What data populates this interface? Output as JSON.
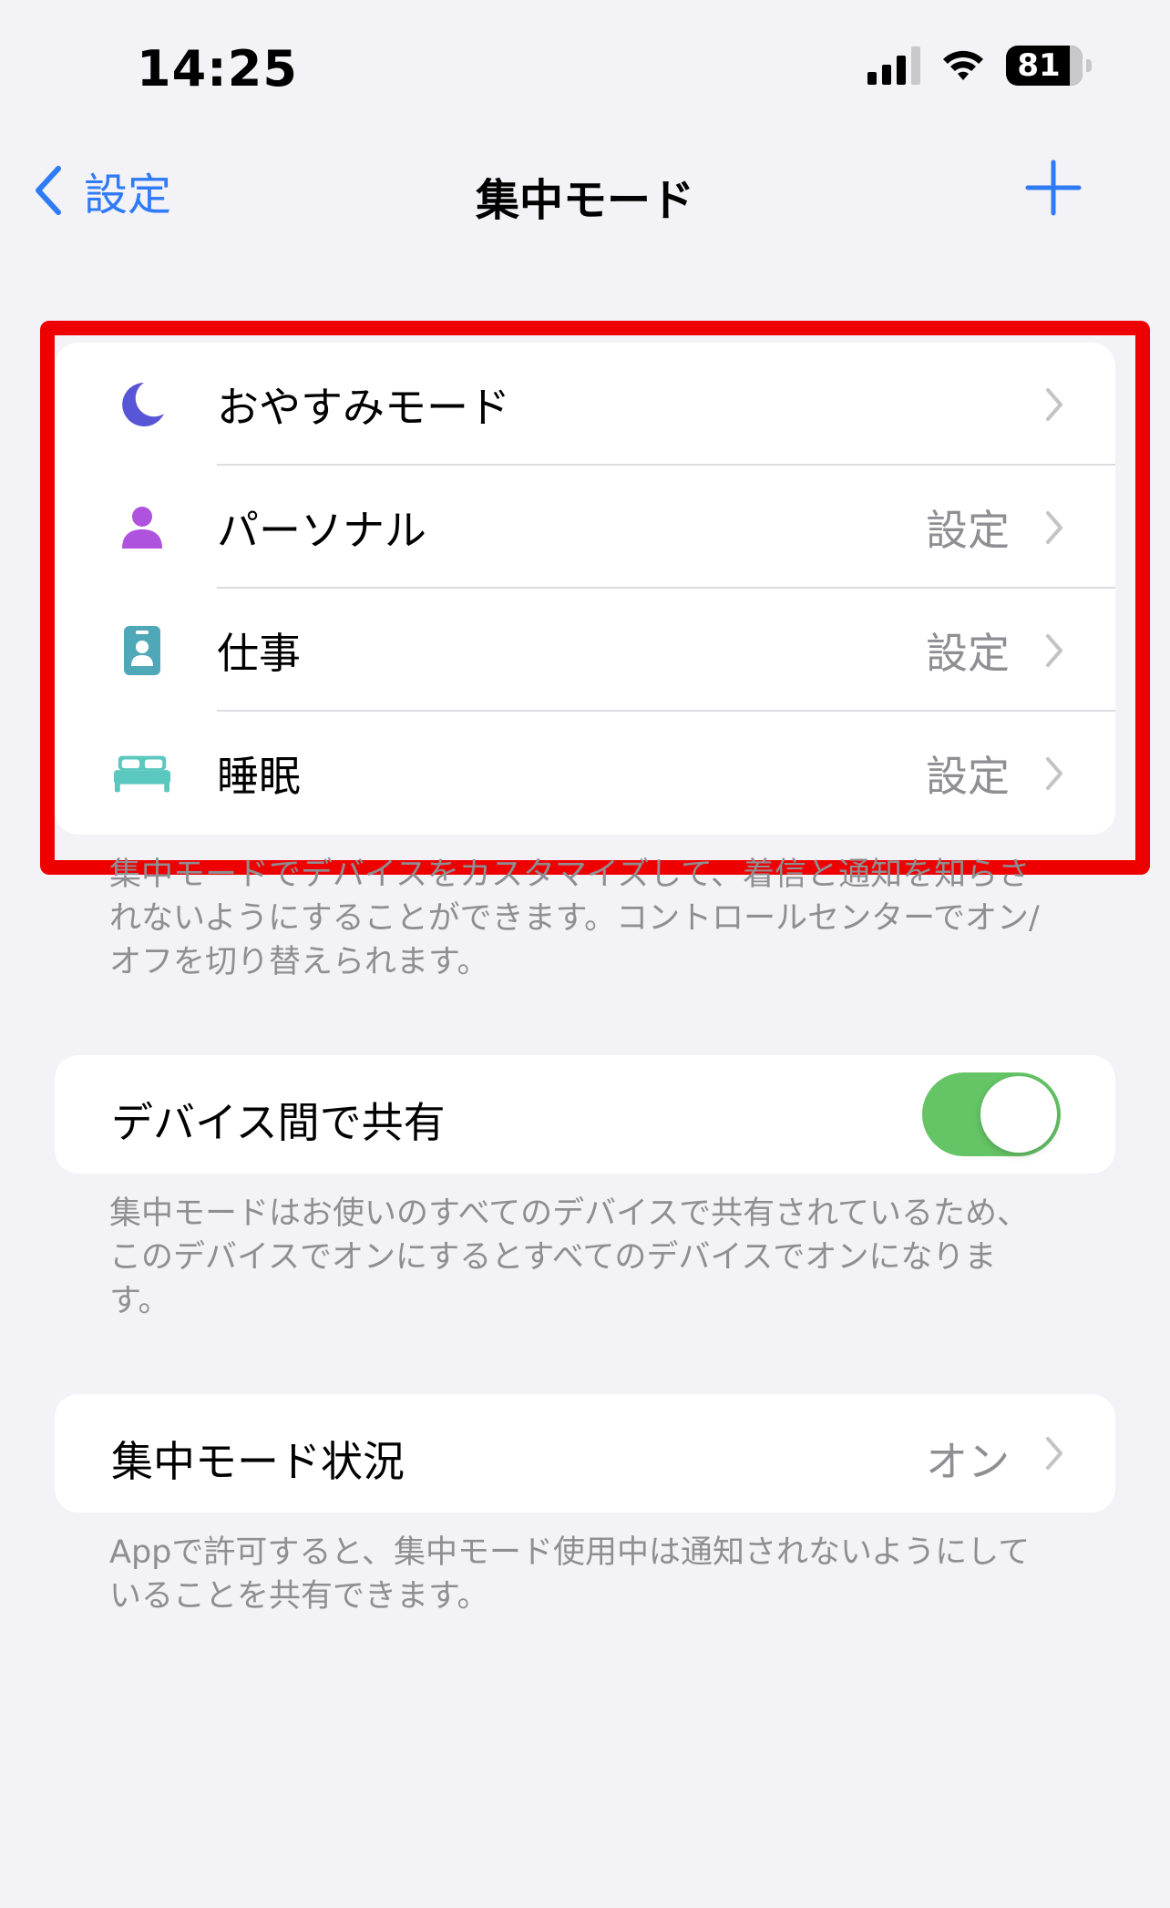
{
  "status_bar": {
    "time": "14:25",
    "battery_level": "81"
  },
  "nav": {
    "back_label": "設定",
    "title": "集中モード"
  },
  "modes": [
    {
      "label": "おやすみモード",
      "detail": "",
      "icon": "moon-icon",
      "color": "#5856d6"
    },
    {
      "label": "パーソナル",
      "detail": "設定",
      "icon": "person-icon",
      "color": "#af52de"
    },
    {
      "label": "仕事",
      "detail": "設定",
      "icon": "id-badge-icon",
      "color": "#4fa8b8"
    },
    {
      "label": "睡眠",
      "detail": "設定",
      "icon": "bed-icon",
      "color": "#5ac8be"
    }
  ],
  "modes_footer": "集中モードでデバイスをカスタマイズして、着信と通知を知らされないようにすることができます。コントロールセンターでオン/オフを切り替えられます。",
  "share": {
    "label": "デバイス間で共有",
    "toggle_on": true,
    "footer": "集中モードはお使いのすべてのデバイスで共有されているため、このデバイスでオンにするとすべてのデバイスでオンになります。"
  },
  "focus_status": {
    "label": "集中モード状況",
    "value": "オン",
    "footer": "Appで許可すると、集中モード使用中は通知されないようにしていることを共有できます。"
  },
  "colors": {
    "accent": "#2f7bf6",
    "toggle_on": "#65c466",
    "highlight": "#ee0000"
  }
}
